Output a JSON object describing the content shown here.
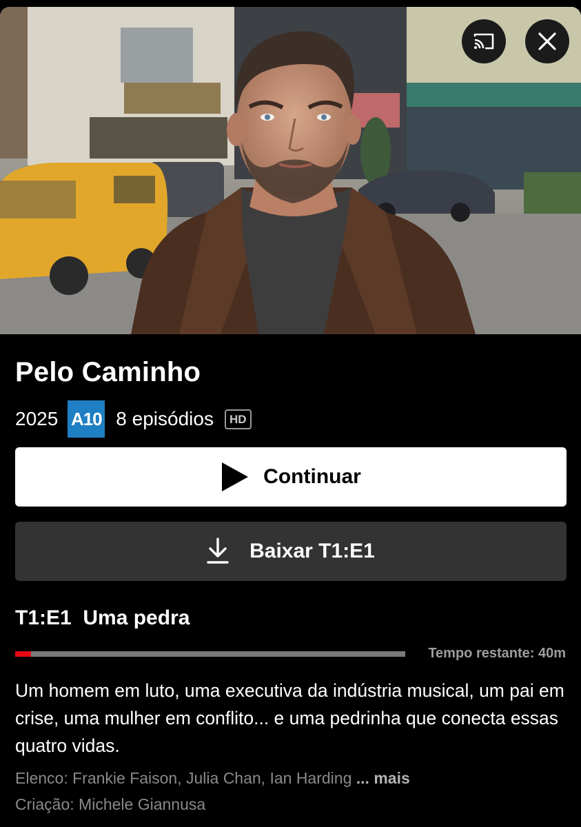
{
  "hero": {
    "cast_icon": "cast-icon",
    "close_icon": "close-icon"
  },
  "show": {
    "title": "Pelo Caminho",
    "year": "2025",
    "rating": "A10",
    "rating_color": "#1f7fc4",
    "episodes": "8 episódios",
    "quality": "HD"
  },
  "actions": {
    "play_label": "Continuar",
    "play_icon": "play-icon",
    "download_label": "Baixar T1:E1",
    "download_icon": "download-icon"
  },
  "episode": {
    "code": "T1:E1",
    "name": "Uma pedra",
    "progress": 0.04,
    "progress_color": "#e50914",
    "remaining": "Tempo restante: 40m"
  },
  "synopsis": "Um homem em luto, uma executiva da indústria musical, um pai em crise, uma mulher em conflito... e uma pedrinha que conecta essas quatro vidas.",
  "credits": {
    "cast_label": "Elenco:",
    "cast": "Frankie Faison, Julia Chan, Ian Harding",
    "more": "... mais",
    "creator_label": "Criação:",
    "creator": "Michele Giannusa"
  }
}
